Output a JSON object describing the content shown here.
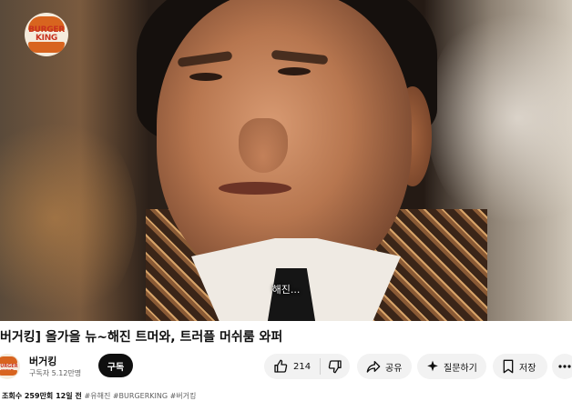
{
  "player": {
    "subtitle": "해진..."
  },
  "brand_logo": {
    "text_line1": "BURGER",
    "text_line2": "KING"
  },
  "video": {
    "title": "버거킹] 올가을 뉴~해진 트머와, 트러플 머쉬룸 와퍼",
    "meta": "조회수 259만회  12일 전",
    "tags": "#유해진 #BURGERKING #버거킹"
  },
  "channel": {
    "name": "버거킹",
    "subscribers": "구독자 5.12만명",
    "avatar_text": "BURGER KING"
  },
  "actions": {
    "subscribe_label": "구독",
    "like_count": "214",
    "share_label": "공유",
    "ask_label": "질문하기",
    "save_label": "저장",
    "like_icon": "thumbs-up-icon",
    "dislike_icon": "thumbs-down-icon",
    "share_icon": "share-arrow-icon",
    "ask_icon": "sparkle-icon",
    "save_icon": "bookmark-icon",
    "more_icon": "more-horizontal-icon"
  },
  "colors": {
    "brand_orange": "#d8641f",
    "brand_red": "#c8321f",
    "subscribe_bg": "#0f0f0f",
    "pill_bg": "#f2f2f2"
  }
}
